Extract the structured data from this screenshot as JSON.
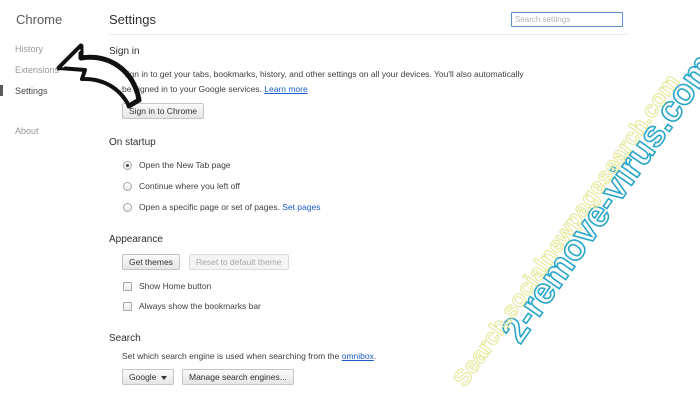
{
  "sidebar": {
    "brand": "Chrome",
    "items": [
      {
        "label": "History"
      },
      {
        "label": "Extensions"
      },
      {
        "label": "Settings"
      },
      {
        "label": "About"
      }
    ]
  },
  "header": {
    "title": "Settings",
    "search_placeholder": "Search settings"
  },
  "sign_in": {
    "title": "Sign in",
    "description_line1": "Sign in to get your tabs, bookmarks, history, and other settings on all your devices. You'll also automatically",
    "description_line2": "be signed in to your Google services.",
    "learn_more": "Learn more",
    "button": "Sign in to Chrome"
  },
  "on_startup": {
    "title": "On startup",
    "options": [
      {
        "label": "Open the New Tab page",
        "checked": true
      },
      {
        "label": "Continue where you left off",
        "checked": false
      },
      {
        "label": "Open a specific page or set of pages.",
        "checked": false
      }
    ],
    "set_pages_link": "Set pages"
  },
  "appearance": {
    "title": "Appearance",
    "get_themes": "Get themes",
    "reset_theme": "Reset to default theme",
    "show_home_button": "Show Home button",
    "show_bookmarks_bar": "Always show the bookmarks bar"
  },
  "search": {
    "title": "Search",
    "description": "Set which search engine is used when searching from the",
    "omnibox_link": "omnibox",
    "description_end": ".",
    "engine": "Google",
    "manage_button": "Manage search engines..."
  },
  "watermarks": {
    "primary": "2-remove-virus.com",
    "secondary": "Search.socialnewpagesearch.com"
  },
  "colors": {
    "link": "#1a5cc8",
    "watermark_primary": "#2aa6c8",
    "watermark_secondary": "#e6e89a"
  }
}
